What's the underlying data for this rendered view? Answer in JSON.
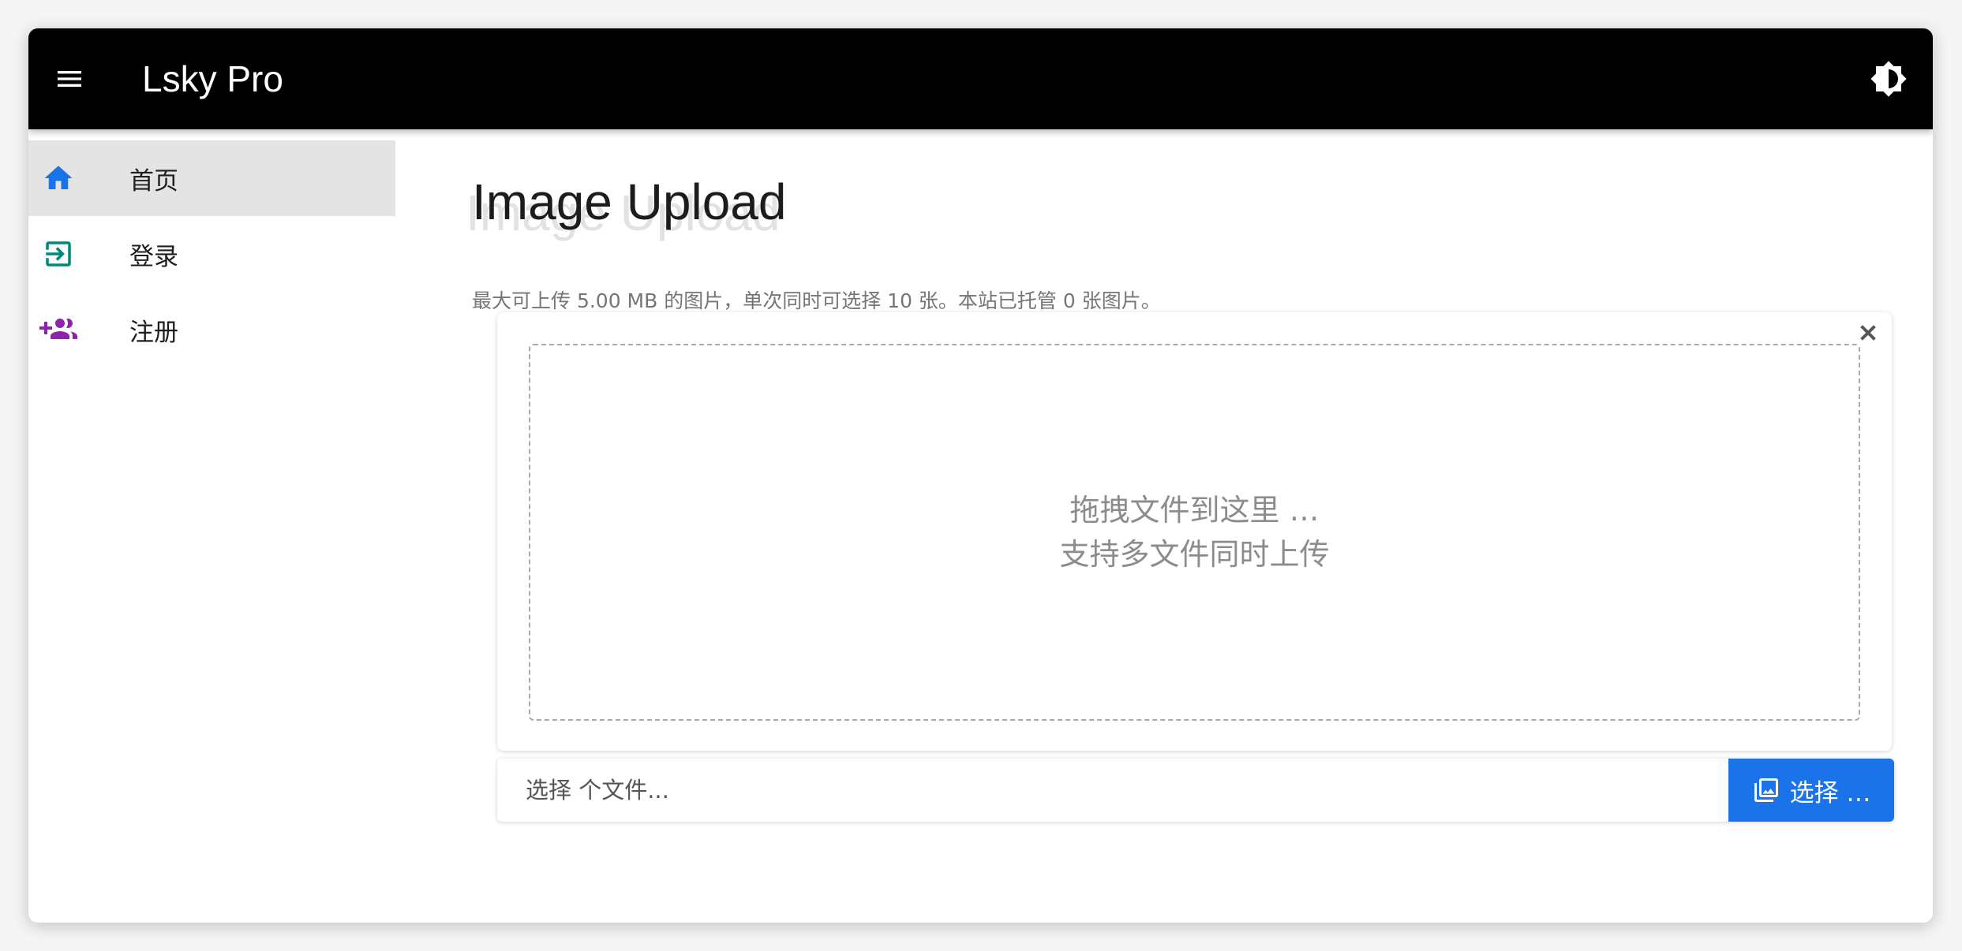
{
  "app": {
    "title": "Lsky Pro"
  },
  "header": {
    "menu_icon": "hamburger-menu-icon",
    "theme_icon": "brightness-contrast-icon"
  },
  "sidebar": {
    "items": [
      {
        "label": "首页",
        "icon": "home-icon",
        "icon_color": "#1a73e8",
        "active": true
      },
      {
        "label": "登录",
        "icon": "login-icon",
        "icon_color": "#00897b",
        "active": false
      },
      {
        "label": "注册",
        "icon": "add-user-icon",
        "icon_color": "#8e24aa",
        "active": false
      }
    ]
  },
  "main": {
    "title": "Image Upload",
    "subtitle": "最大可上传 5.00 MB 的图片，单次同时可选择 10 张。本站已托管 0 张图片。",
    "dropzone": {
      "line1": "拖拽文件到这里 …",
      "line2": "支持多文件同时上传",
      "close_icon": "close-icon"
    },
    "file_input": {
      "caption": "选择 个文件...",
      "button_label": "选择 …",
      "button_icon": "image-gallery-icon"
    }
  },
  "colors": {
    "appbar": "#000000",
    "accent": "#1a73e8",
    "active_nav_bg": "#e4e4e4"
  }
}
